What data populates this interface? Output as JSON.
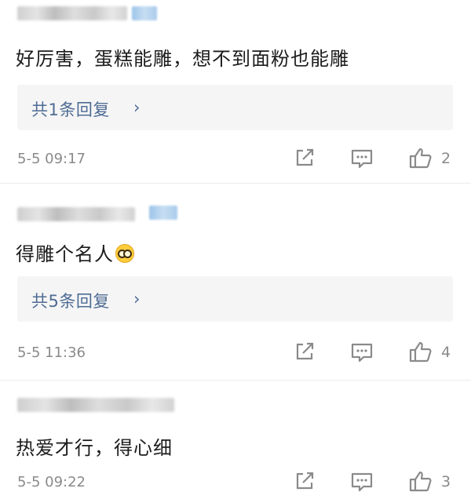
{
  "comments": [
    {
      "text": "好厉害，蛋糕能雕，想不到面粉也能雕",
      "replies_label": "共1条回复",
      "time": "5-5 09:17",
      "likes": "2"
    },
    {
      "text": "得雕个名人",
      "replies_label": "共5条回复",
      "time": "5-5 11:36",
      "likes": "4"
    },
    {
      "text": "热爱才行，得心细",
      "time": "5-5 09:22",
      "likes": "3"
    }
  ],
  "icons": {
    "share": "share-icon",
    "reply": "comment-icon",
    "like": "thumbs-up-icon",
    "chevron": "chevron-right-icon",
    "emoji": "sunglasses-emoji-icon"
  },
  "colors": {
    "link": "#4e6c94",
    "meta": "#8a8a8a",
    "reply_bg": "#f5f5f5"
  }
}
